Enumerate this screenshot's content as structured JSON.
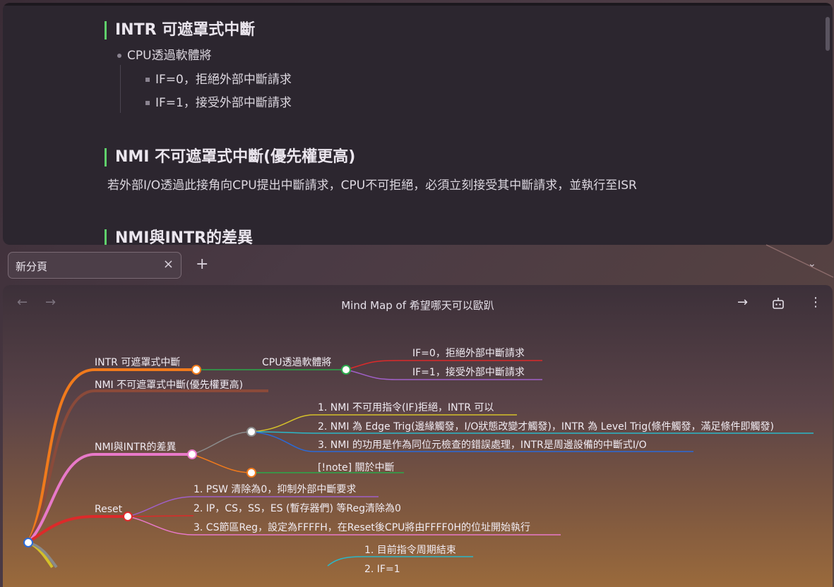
{
  "editor": {
    "h1": "INTR 可遮罩式中斷",
    "h1_b1": "CPU透過軟體將",
    "h1_b1_s1": "IF=0，拒絕外部中斷請求",
    "h1_b1_s2": "IF=1，接受外部中斷請求",
    "h2": "NMI 不可遮罩式中斷(優先權更高)",
    "h2_para": "若外部I/O透過此接角向CPU提出中斷請求，CPU不可拒絕，必須立刻接受其中斷請求，並執行至ISR",
    "h3": "NMI與INTR的差異"
  },
  "tabs": {
    "new_tab_label": "新分頁",
    "close_icon": "×",
    "add_icon": "+",
    "chevron_icon": "⌄"
  },
  "mindmap": {
    "title": "Mind Map of 希望哪天可以歐趴",
    "back_icon": "←",
    "forward_icon": "→",
    "open_icon": "→",
    "bot_icon": "🤖",
    "more_icon": "⋮",
    "nodes": {
      "intr": "INTR 可遮罩式中斷",
      "cpu_sw": "CPU透過軟體將",
      "if0": "IF=0，拒絕外部中斷請求",
      "if1": "IF=1，接受外部中斷請求",
      "nmi": "NMI 不可遮罩式中斷(優先權更高)",
      "diff": "NMI與INTR的差異",
      "d1": "1. NMI 不可用指令(IF)拒絕，INTR 可以",
      "d2": "2. NMI 為 Edge Trig(邊緣觸發，I/O狀態改變才觸發)，INTR 為 Level Trig(條件觸發，滿足條件即觸發)",
      "d3": "3. NMI 的功用是作為同位元檢查的錯誤處理，INTR是周邊設備的中斷式I/O",
      "note": "[!note] 關於中斷",
      "reset": "Reset",
      "r1": "1. PSW 清除為0，抑制外部中斷要求",
      "r2": "2. IP，CS，SS，ES (暫存器們) 等Reg清除為0",
      "r3": "3. CS節區Reg，設定為FFFFH，在Reset後CPU將由FFFF0H的位址開始執行",
      "next1": "1. 目前指令周期結束",
      "next2": "2. IF=1"
    },
    "colors": {
      "orange": "#f07a1c",
      "brown": "#8a4a3a",
      "pink": "#e879c8",
      "red": "#dc2a2a",
      "green": "#2aa84a",
      "yellow": "#d4c02a",
      "cyan": "#2ab8c8",
      "blue": "#2a6ad8",
      "purple": "#a060c8",
      "gray": "#8a8a8a"
    }
  }
}
